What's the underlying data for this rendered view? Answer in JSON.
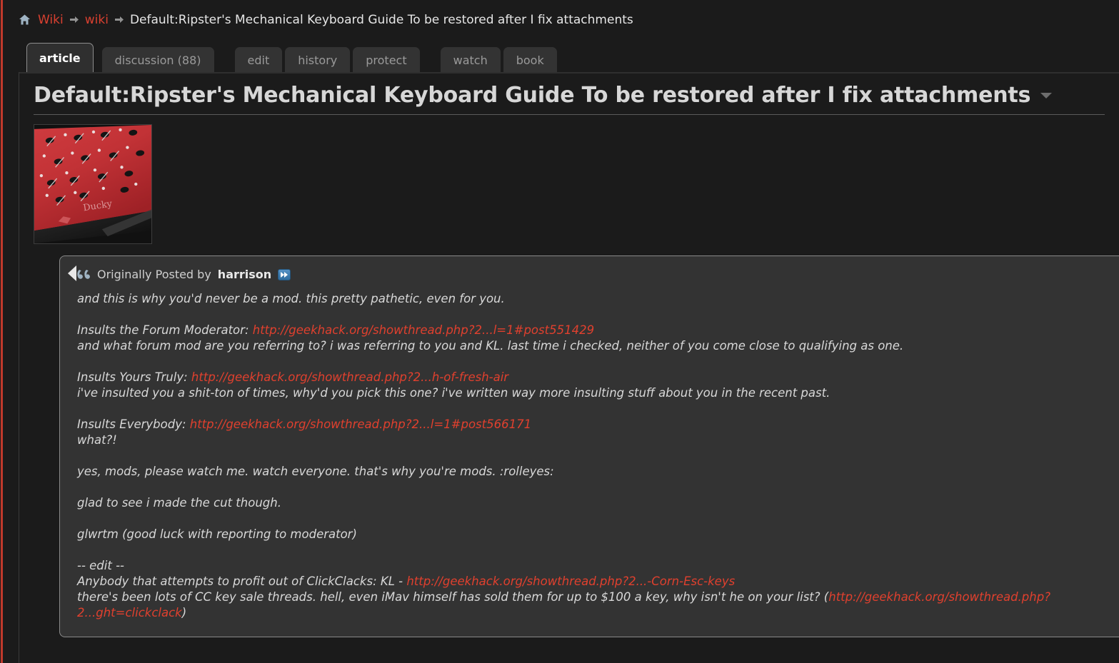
{
  "colors": {
    "accent_red": "#d94030",
    "link_red": "#e0402e",
    "page_bg": "#1b1b1b",
    "quote_bg": "#333333",
    "tab_bg": "#333333",
    "badge_blue": "#2f6d9f"
  },
  "breadcrumb": {
    "home_icon": "home-icon",
    "separator_icon": "arrow-right-icon",
    "items": [
      {
        "label": "Wiki",
        "type": "link"
      },
      {
        "label": "wiki",
        "type": "link"
      },
      {
        "label": "Default:Ripster's Mechanical Keyboard Guide To be restored after I fix attachments",
        "type": "current"
      }
    ]
  },
  "tabs": [
    {
      "label": "article",
      "active": true
    },
    {
      "label": "discussion (88)",
      "active": false
    },
    {
      "label": "edit",
      "active": false
    },
    {
      "label": "history",
      "active": false
    },
    {
      "label": "protect",
      "active": false
    },
    {
      "label": "watch",
      "active": false
    },
    {
      "label": "book",
      "active": false
    }
  ],
  "article": {
    "title": "Default:Ripster's Mechanical Keyboard Guide To be restored after I fix attachments",
    "title_dropdown_icon": "chevron-down-icon",
    "thumbnail": {
      "alt": "Red Ducky mechanical keyboard PCB with diodes",
      "name": "article-thumbnail"
    }
  },
  "quote": {
    "quote_icon": "quote-marks-icon",
    "attribution_prefix": "Originally Posted by",
    "author": "harrison",
    "view_post_icon": "view-post-icon",
    "paragraphs": [
      {
        "lines": [
          {
            "segments": [
              {
                "text": "and this is why you'd never be a mod. this pretty pathetic, even for you.",
                "type": "text"
              }
            ]
          }
        ]
      },
      {
        "lines": [
          {
            "segments": [
              {
                "text": "Insults the Forum Moderator: ",
                "type": "text"
              },
              {
                "text": "http://geekhack.org/showthread.php?2...l=1#post551429",
                "type": "link"
              }
            ]
          },
          {
            "segments": [
              {
                "text": "and what forum mod are you referring to? i was referring to you and KL. last time i checked, neither of you come close to qualifying as one.",
                "type": "text"
              }
            ]
          }
        ]
      },
      {
        "lines": [
          {
            "segments": [
              {
                "text": "Insults Yours Truly: ",
                "type": "text"
              },
              {
                "text": "http://geekhack.org/showthread.php?2...h-of-fresh-air",
                "type": "link"
              }
            ]
          },
          {
            "segments": [
              {
                "text": "i've insulted you a shit-ton of times, why'd you pick this one? i've written way more insulting stuff about you in the recent past.",
                "type": "text"
              }
            ]
          }
        ]
      },
      {
        "lines": [
          {
            "segments": [
              {
                "text": "Insults Everybody: ",
                "type": "text"
              },
              {
                "text": "http://geekhack.org/showthread.php?2...l=1#post566171",
                "type": "link"
              }
            ]
          },
          {
            "segments": [
              {
                "text": "what?!",
                "type": "text"
              }
            ]
          }
        ]
      },
      {
        "lines": [
          {
            "segments": [
              {
                "text": "yes, mods, please watch me. watch everyone. that's why you're mods. :rolleyes:",
                "type": "text"
              }
            ]
          }
        ]
      },
      {
        "lines": [
          {
            "segments": [
              {
                "text": "glad to see i made the cut though.",
                "type": "text"
              }
            ]
          }
        ]
      },
      {
        "lines": [
          {
            "segments": [
              {
                "text": "glwrtm (good luck with reporting to moderator)",
                "type": "text"
              }
            ]
          }
        ]
      },
      {
        "lines": [
          {
            "segments": [
              {
                "text": "-- edit --",
                "type": "text"
              }
            ]
          },
          {
            "segments": [
              {
                "text": "Anybody that attempts to profit out of ClickClacks: KL - ",
                "type": "text"
              },
              {
                "text": "http://geekhack.org/showthread.php?2...-Corn-Esc-keys",
                "type": "link"
              }
            ]
          },
          {
            "segments": [
              {
                "text": "there's been lots of CC key sale threads. hell, even iMav himself has sold them for up to $100 a key, why isn't he on your list? (",
                "type": "text"
              },
              {
                "text": "http://geekhack.org/showthread.php?2...ght=clickclack",
                "type": "link"
              },
              {
                "text": ")",
                "type": "text"
              }
            ]
          }
        ]
      }
    ]
  }
}
